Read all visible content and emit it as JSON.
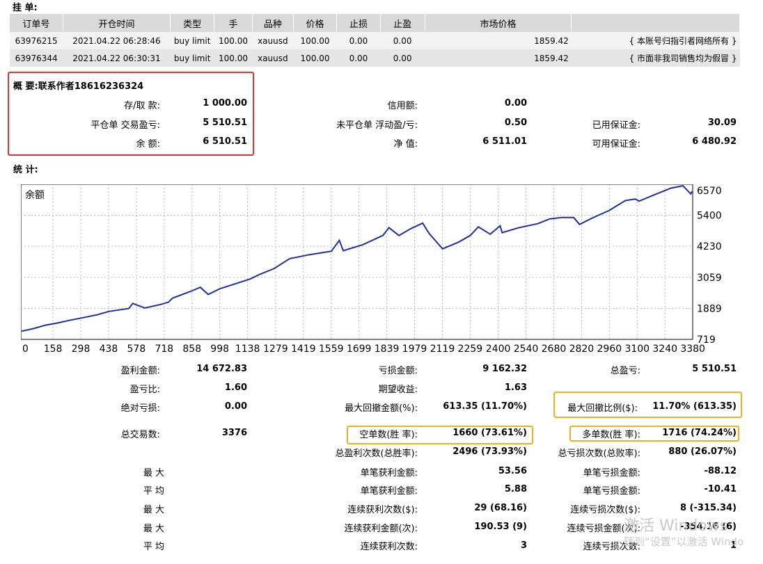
{
  "orders": {
    "title": "挂 单:",
    "columns": [
      "订单号",
      "开仓时间",
      "类型",
      "手",
      "品种",
      "价格",
      "止损",
      "止盈",
      "市场价格",
      ""
    ],
    "rows": [
      {
        "id": "63976215",
        "time": "2021.04.22 06:28:46",
        "type": "buy limit",
        "lots": "100.00",
        "symbol": "xauusd",
        "price": "100.00",
        "sl": "0.00",
        "tp": "0.00",
        "market": "1859.42",
        "note": "{ 本账号归指引者网络所有 }"
      },
      {
        "id": "63976344",
        "time": "2021.04.22 06:30:31",
        "type": "buy limit",
        "lots": "100.00",
        "symbol": "xauusd",
        "price": "100.00",
        "sl": "0.00",
        "tp": "0.00",
        "market": "1859.42",
        "note": "{ 市面非我司销售均为假冒 }"
      }
    ]
  },
  "summary": {
    "title": "概 要:联系作者18616236324",
    "deposit_label": "存/取 款:",
    "deposit": "1 000.00",
    "closed_pl_label": "平仓单 交易盈亏:",
    "closed_pl": "5 510.51",
    "balance_label": "余 额:",
    "balance": "6 510.51",
    "credit_label": "信用额:",
    "credit": "0.00",
    "floating_label": "未平仓单 浮动盈/亏:",
    "floating": "0.50",
    "equity_label": "净 值:",
    "equity": "6 511.01",
    "margin_label": "已用保证金:",
    "margin": "30.09",
    "free_margin_label": "可用保证金:",
    "free_margin": "6 480.92"
  },
  "stats_title": "统 计:",
  "chart_data": {
    "type": "line",
    "title": "余额",
    "xlim": [
      0,
      3376
    ],
    "ylim": [
      719,
      6570
    ],
    "x_ticks": [
      "0",
      "158",
      "298",
      "438",
      "578",
      "718",
      "858",
      "998",
      "1138",
      "1279",
      "1419",
      "1559",
      "1699",
      "1839",
      "1979",
      "2119",
      "2259",
      "2400",
      "2540",
      "2680",
      "2820",
      "2960",
      "3100",
      "3240",
      "3380"
    ],
    "y_ticks": [
      6570,
      5400,
      4230,
      3059,
      1889,
      719
    ],
    "color": "#1f2fa0",
    "series": [
      {
        "x": [
          0,
          60,
          120,
          180,
          240,
          300,
          380,
          440,
          540,
          560,
          620,
          700,
          740,
          760,
          860,
          900,
          940,
          1000,
          1080,
          1150,
          1200,
          1270,
          1350,
          1450,
          1560,
          1600,
          1620,
          1720,
          1820,
          1850,
          1900,
          1960,
          2020,
          2050,
          2120,
          2200,
          2260,
          2300,
          2360,
          2410,
          2420,
          2500,
          2600,
          2660,
          2720,
          2780,
          2810,
          2870,
          2960,
          3040,
          3090,
          3110,
          3190,
          3270,
          3330,
          3370,
          3378
        ],
        "y": [
          1025,
          1125,
          1255,
          1335,
          1435,
          1525,
          1645,
          1775,
          1885,
          2075,
          1905,
          2035,
          2125,
          2275,
          2555,
          2685,
          2415,
          2635,
          2825,
          2995,
          3175,
          3385,
          3765,
          3915,
          4045,
          4455,
          4065,
          4295,
          4645,
          4935,
          4635,
          4895,
          5105,
          4735,
          4135,
          4385,
          4645,
          4965,
          4685,
          5005,
          4745,
          4925,
          5085,
          5265,
          5315,
          5315,
          5055,
          5285,
          5585,
          5955,
          6015,
          5935,
          6185,
          6425,
          6515,
          6205,
          6305
        ]
      }
    ]
  },
  "stats": {
    "gross_profit_label": "盈利金额:",
    "gross_profit": "14 672.83",
    "gross_loss_label": "亏损金额:",
    "gross_loss": "9 162.32",
    "total_pl_label": "总盈亏:",
    "total_pl": "5 510.51",
    "profit_factor_label": "盈亏比:",
    "profit_factor": "1.60",
    "expected_label": "期望收益:",
    "expected": "1.63",
    "abs_dd_label": "绝对亏损:",
    "abs_dd": "0.00",
    "max_dd_label": "最大回撤金额(%):",
    "max_dd": "613.35 (11.70%)",
    "rel_dd_label": "最大回撤比例($):",
    "rel_dd": "11.70% (613.35)",
    "total_trades_label": "总交易数:",
    "total_trades": "3376",
    "short_label": "空单数(胜 率):",
    "short": "1660 (73.61%)",
    "long_label": "多单数(胜 率):",
    "long": "1716 (74.24%)",
    "profit_trades_label": "总盈利次数(总胜率):",
    "profit_trades": "2496 (73.93%)",
    "loss_trades_label": "总亏损次数(总败率):",
    "loss_trades": "880 (26.07%)",
    "max1_label": "最 大",
    "avg1_label": "平 均",
    "max2_label": "最 大",
    "max3_label": "最 大",
    "avg2_label": "平 均",
    "largest_win_label": "单笔获利金额:",
    "largest_win": "53.56",
    "largest_loss_label": "单笔亏损金额:",
    "largest_loss": "-88.12",
    "avg_win_label": "单笔获利金额:",
    "avg_win": "5.88",
    "avg_loss_label": "单笔亏损金额:",
    "avg_loss": "-10.41",
    "cons_wins_label": "连续获利次数($):",
    "cons_wins": "29 (68.16)",
    "cons_losses_label": "连续亏损次数($):",
    "cons_losses": "8 (-315.34)",
    "cons_profit_label": "连续获利金额(次):",
    "cons_profit": "190.53 (9)",
    "cons_loss_label": "连续亏损金额(次):",
    "cons_loss": "-354.16 (6)",
    "avg_cons_wins_label": "连续获利次数:",
    "avg_cons_wins": "3",
    "avg_cons_losses_label": "连续亏损次数:",
    "avg_cons_losses": "1"
  },
  "watermark": {
    "line1": "激活 Windows",
    "line2": "转到“设置”以激活 Windo"
  }
}
